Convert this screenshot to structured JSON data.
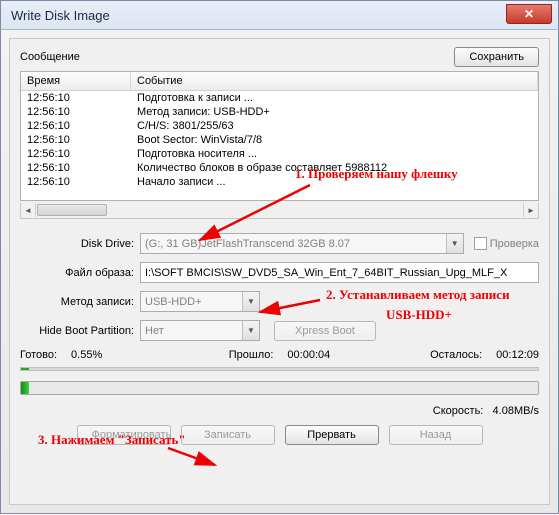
{
  "window": {
    "title": "Write Disk Image"
  },
  "message": {
    "label": "Сообщение",
    "save_btn": "Сохранить"
  },
  "log": {
    "col_time": "Время",
    "col_event": "Событие",
    "rows": [
      {
        "t": "12:56:10",
        "e": "Подготовка к записи ..."
      },
      {
        "t": "12:56:10",
        "e": "Метод записи: USB-HDD+"
      },
      {
        "t": "12:56:10",
        "e": "C/H/S: 3801/255/63"
      },
      {
        "t": "12:56:10",
        "e": "Boot Sector: WinVista/7/8"
      },
      {
        "t": "12:56:10",
        "e": "Подготовка носителя ..."
      },
      {
        "t": "12:56:10",
        "e": "Количество блоков в образе составляет 5988112"
      },
      {
        "t": "12:56:10",
        "e": "Начало записи ..."
      }
    ]
  },
  "fields": {
    "disk_drive_label": "Disk Drive:",
    "disk_drive_value": "(G:, 31 GB)JetFlashTranscend 32GB  8.07",
    "check_label": "Проверка",
    "image_file_label": "Файл образа:",
    "image_file_value": "I:\\SOFT BMCIS\\SW_DVD5_SA_Win_Ent_7_64BIT_Russian_Upg_MLF_X",
    "write_method_label": "Метод записи:",
    "write_method_value": "USB-HDD+",
    "hide_boot_label": "Hide Boot Partition:",
    "hide_boot_value": "Нет",
    "xpress_boot": "Xpress Boot"
  },
  "progress": {
    "done_label": "Готово:",
    "done_pct": "0.55%",
    "elapsed_label": "Прошло:",
    "elapsed_val": "00:00:04",
    "remain_label": "Осталось:",
    "remain_val": "00:12:09",
    "speed_label": "Скорость:",
    "speed_val": "4.08MB/s"
  },
  "buttons": {
    "format": "Форматировать",
    "write": "Записать",
    "abort": "Прервать",
    "back": "Назад"
  },
  "annotations": {
    "a1": "1. Проверяем нашу флешку",
    "a2": "2. Устанавливаем метод записи",
    "a3": "USB-HDD+",
    "a4": "3. Нажимаем \"Записать\""
  }
}
